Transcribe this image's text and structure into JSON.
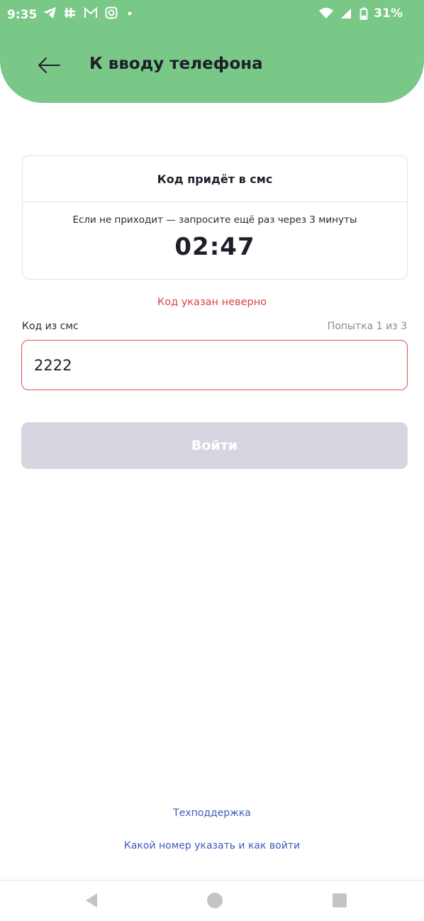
{
  "status_bar": {
    "time": "9:35",
    "battery": "31%",
    "icons_left": [
      "telegram-icon",
      "grid-app-icon",
      "gmail-icon",
      "instagram-icon",
      "dot-icon"
    ],
    "icons_right": [
      "wifi-icon",
      "signal-icon",
      "battery-icon"
    ]
  },
  "header": {
    "title": "К вводу телефона",
    "background": "#7ac887"
  },
  "info_card": {
    "heading": "Код придёт в смс",
    "note": "Если не приходит — запросите ещё раз через 3 минуты",
    "timer": "02:47"
  },
  "form": {
    "error": "Код указан неверно",
    "label": "Код из смс",
    "attempts": "Попытка 1 из 3",
    "code_value": "2222",
    "error_color": "#d9433f"
  },
  "login_button": {
    "label": "Войти",
    "state": "disabled",
    "background": "#d7d5e0"
  },
  "links": {
    "support": "Техподдержка",
    "help": "Какой номер указать и как войти",
    "color": "#3b5dbf"
  },
  "nav": {
    "items": [
      "back-icon",
      "home-icon",
      "recents-icon"
    ]
  }
}
